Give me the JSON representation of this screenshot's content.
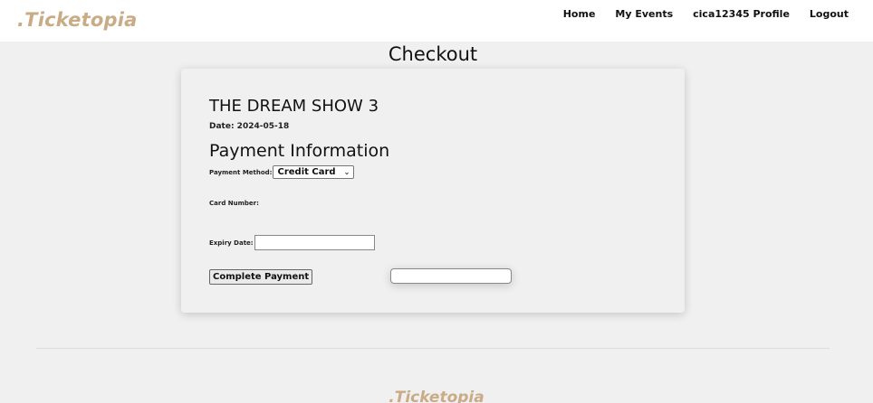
{
  "brand": {
    "name": ".Ticketopia",
    "color": "#c9ab85"
  },
  "nav": {
    "items": [
      {
        "label": "Home"
      },
      {
        "label": "My Events"
      },
      {
        "label": "cica12345 Profile"
      },
      {
        "label": "Logout"
      }
    ]
  },
  "page": {
    "title": "Checkout"
  },
  "event": {
    "name": "THE DREAM SHOW 3",
    "date": "Date: 2024-05-18"
  },
  "payment": {
    "section_title": "Payment Information",
    "method_label": "Payment Method:",
    "method_value": "Credit Card",
    "card_number_label": "Card Number:",
    "card_number_value": "",
    "expiry_label": "Expiry Date:",
    "expiry_value": "",
    "submit_label": "Complete Payment"
  },
  "footer": {
    "brand": ".Ticketopia"
  }
}
